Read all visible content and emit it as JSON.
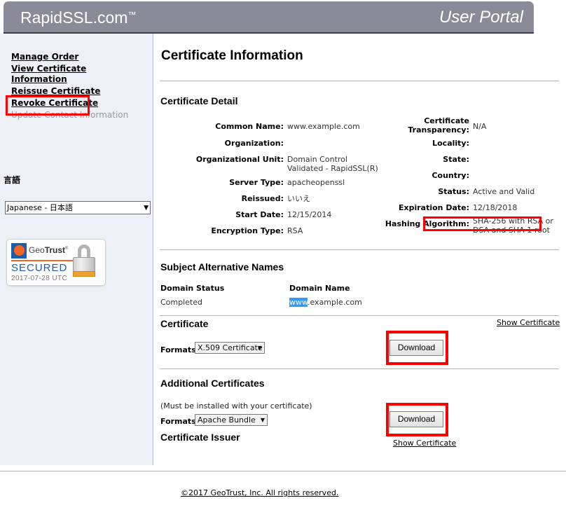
{
  "header": {
    "brand": "RapidSSL.com",
    "brand_tm": "™",
    "portal_title": "User Portal"
  },
  "sidebar": {
    "nav_items": [
      {
        "label": "Manage Order",
        "state": "link"
      },
      {
        "label": "View Certificate Information",
        "state": "link-active"
      },
      {
        "label": "Reissue Certificate",
        "state": "link"
      },
      {
        "label": "Revoke Certificate",
        "state": "link"
      },
      {
        "label": "Update Contact Information",
        "state": "disabled"
      }
    ],
    "language_label": "言語",
    "language_value": "Japanese - 日本語",
    "caret": "▼",
    "seal": {
      "brand_prefix": "Geo",
      "brand_suffix": "Trust",
      "registered": "®",
      "secured": "SECURED",
      "date": "2017-07-28 UTC"
    }
  },
  "main": {
    "page_title": "Certificate Information",
    "sections": {
      "certificate_detail": "Certificate Detail",
      "subject_alternative_names": "Subject Alternative Names",
      "certificate": "Certificate",
      "additional_certificates": "Additional Certificates",
      "certificate_issuer": "Certificate Issuer"
    },
    "detail_left": [
      {
        "label": "Common Name:",
        "value": "www.example.com"
      },
      {
        "label": "Organization:",
        "value": ""
      },
      {
        "label": "Organizational Unit:",
        "value": "Domain Control Validated - RapidSSL(R)"
      },
      {
        "label": "Server Type:",
        "value": "apacheopenssl"
      },
      {
        "label": "Reissued:",
        "value": "いいえ"
      },
      {
        "label": "Start Date:",
        "value": "12/15/2014"
      },
      {
        "label": "Encryption Type:",
        "value": "RSA"
      }
    ],
    "detail_right": [
      {
        "label": "Certificate Transparency:",
        "value": "N/A"
      },
      {
        "label": "Locality:",
        "value": ""
      },
      {
        "label": "State:",
        "value": ""
      },
      {
        "label": "Country:",
        "value": ""
      },
      {
        "label": "Status:",
        "value": "Active and Valid"
      },
      {
        "label": "Expiration Date:",
        "value": "12/18/2018"
      },
      {
        "label": "Hashing Algorithm:",
        "value": "SHA-256 with RSA or DSA and SHA-1 root"
      }
    ],
    "san_table": {
      "columns": [
        "Domain Status",
        "Domain Name"
      ],
      "rows": [
        {
          "status": "Completed",
          "domain_selected": "www",
          "domain_rest": ".example.com"
        }
      ]
    },
    "certificate_block": {
      "formats_label": "Formats:",
      "format_value": "X.509 Certificate",
      "caret": "▼",
      "download_label": "Download",
      "show_certificate": "Show Certificate"
    },
    "additional_block": {
      "note": "(Must be installed with your certificate)",
      "formats_label": "Formats:",
      "format_value": "Apache Bundle",
      "caret": "▼",
      "download_label": "Download",
      "show_certificate": "Show Certificate"
    }
  },
  "footer": {
    "copyright": "©2017 GeoTrust, Inc. All rights reserved."
  },
  "colors": {
    "header_bar": "#8a8a99",
    "sidebar_bg": "#eef0f7",
    "annotation_red": "#ff0000",
    "selection_blue": "#3399ff",
    "seal_blue": "#1a5fae",
    "seal_orange": "#f26522"
  }
}
